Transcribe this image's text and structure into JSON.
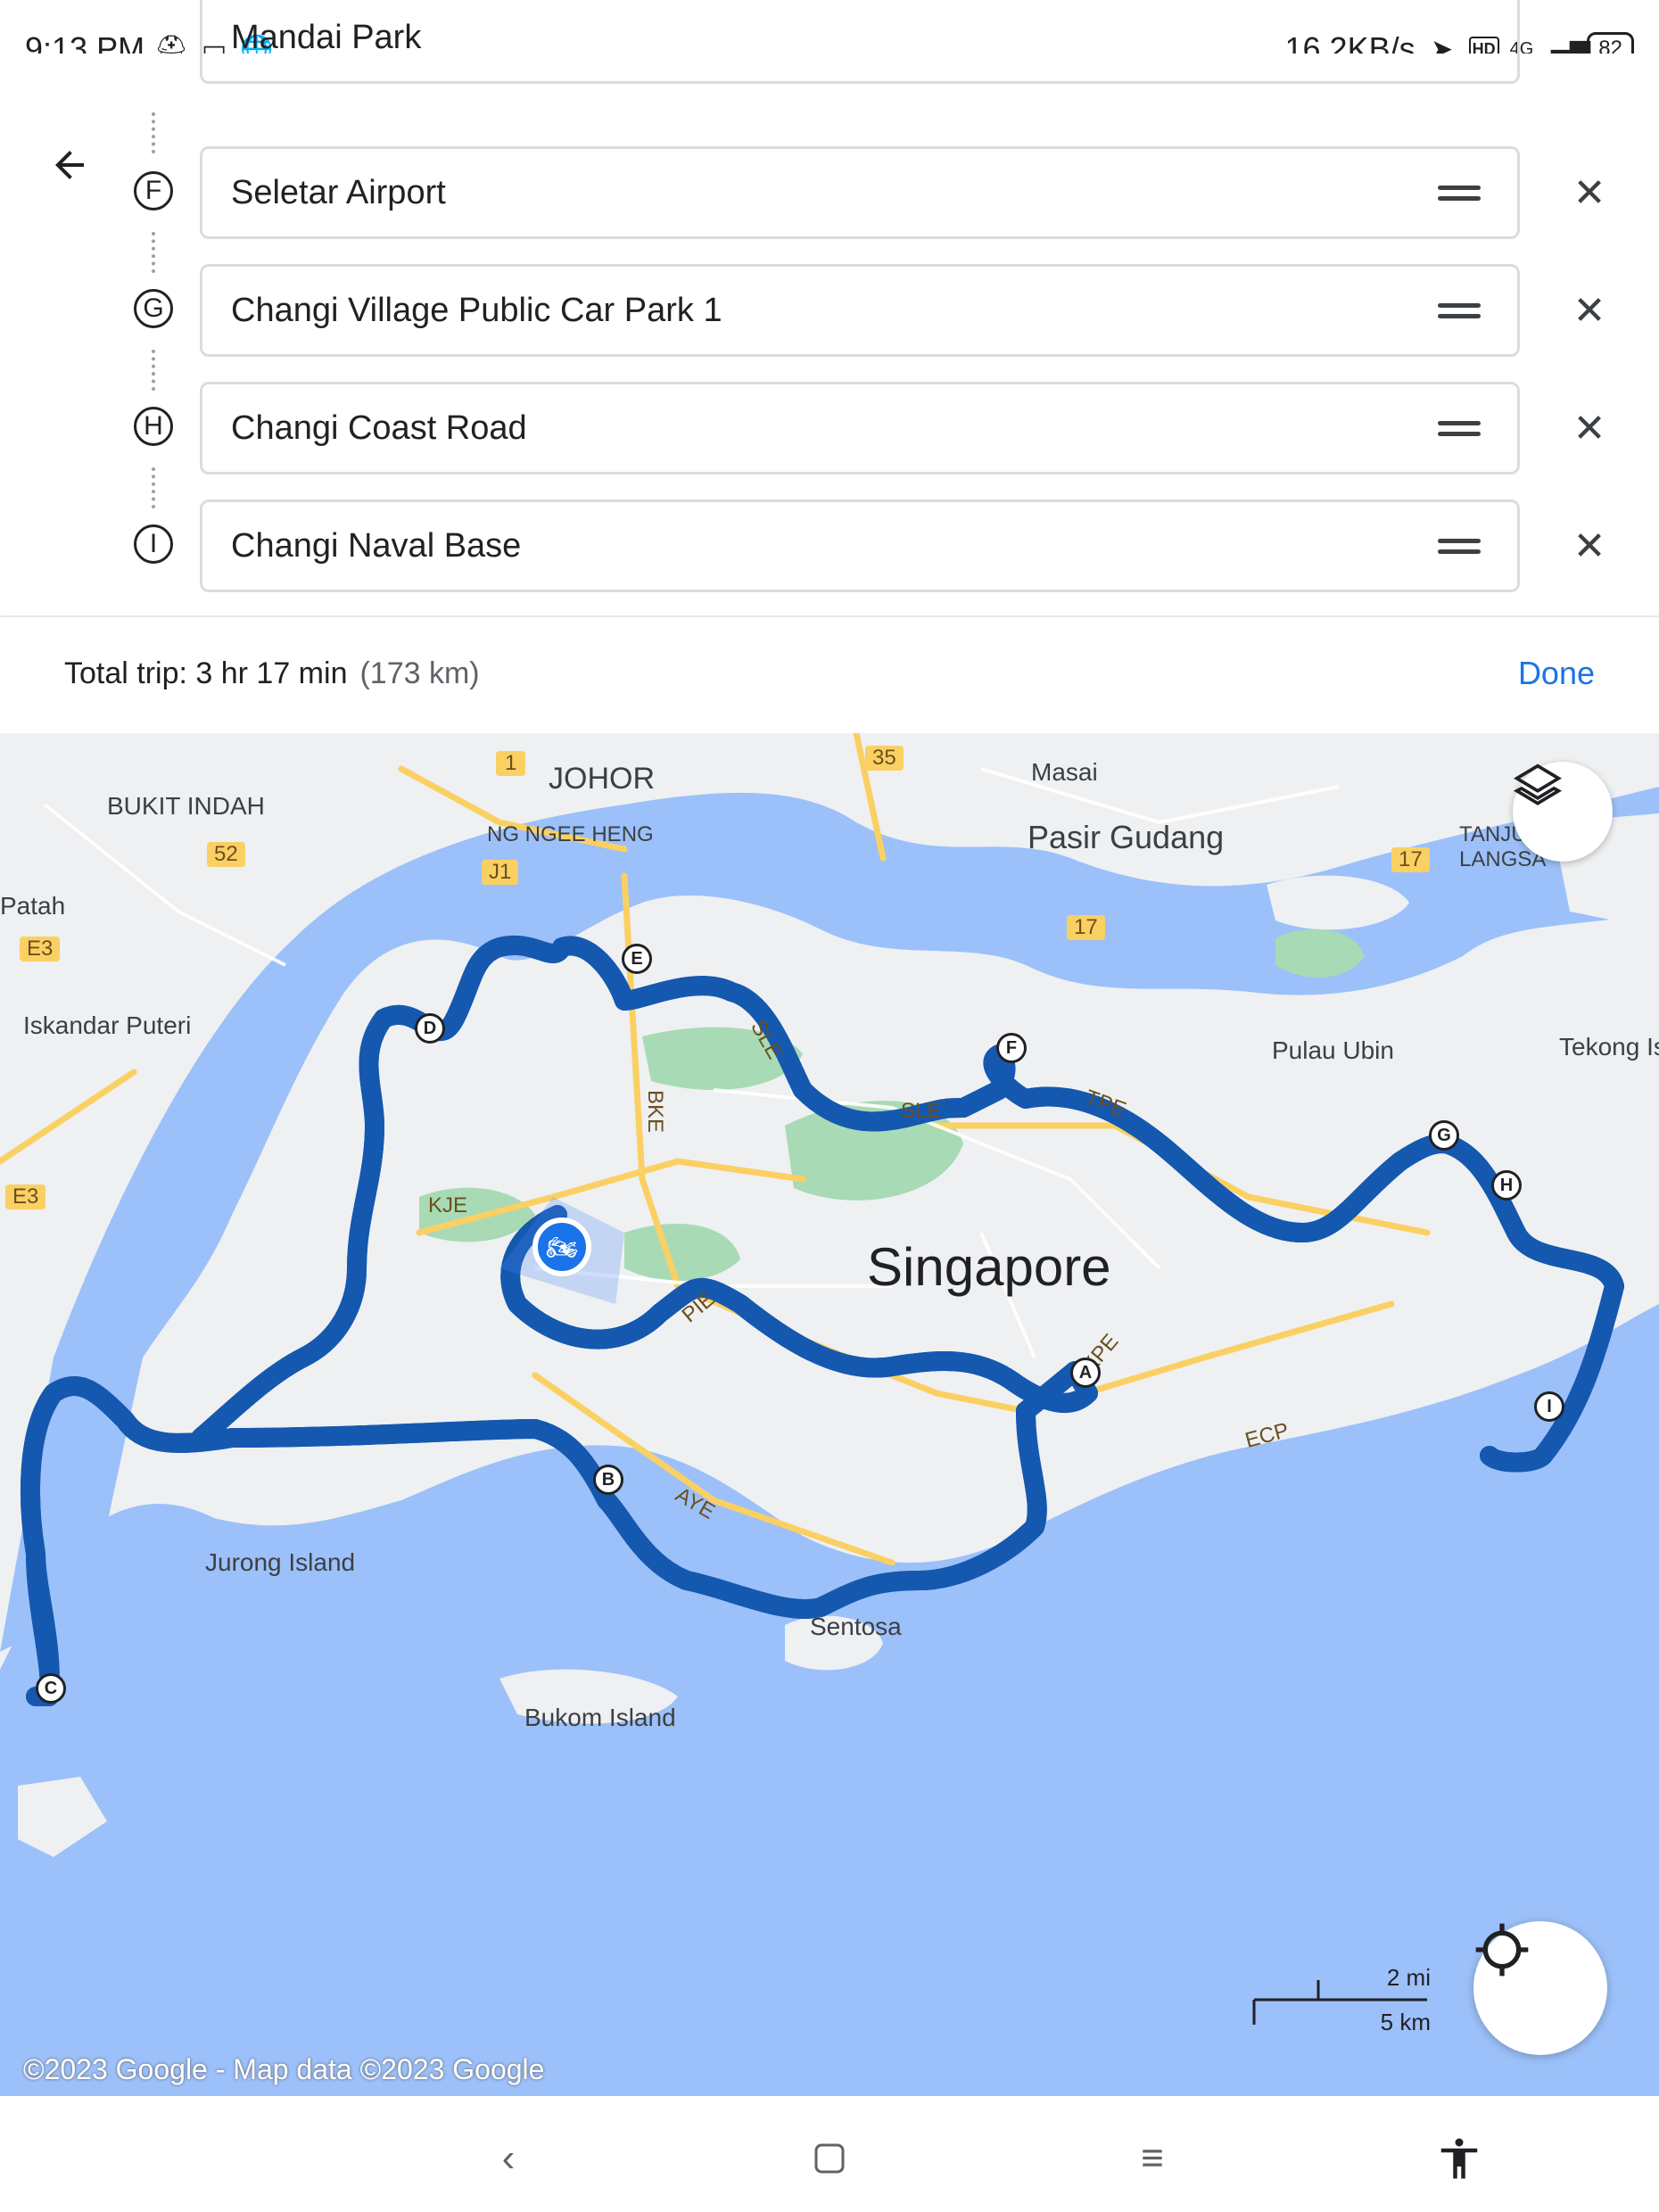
{
  "status_bar": {
    "time": "9:13 PM",
    "speed": "16.2KB/s",
    "network": "4G",
    "battery": "82"
  },
  "stops": [
    {
      "letter": "F",
      "name": "Seletar Airport"
    },
    {
      "letter": "G",
      "name": "Changi Village Public Car Park 1"
    },
    {
      "letter": "H",
      "name": "Changi Coast Road"
    },
    {
      "letter": "I",
      "name": "Changi Naval Base"
    }
  ],
  "partial_stop": "Mandai Park",
  "trip": {
    "label": "Total trip: 3 hr 17 min",
    "distance": "(173 km)",
    "done_label": "Done"
  },
  "map": {
    "labels": {
      "johor": "JOHOR",
      "bukit_indah": "BUKIT INDAH",
      "ng_ngee_heng": "NG NGEE HENG",
      "masai": "Masai",
      "pasir_gudang": "Pasir Gudang",
      "tanjung": "TANJU LANGSA",
      "patah": "Patah",
      "iskandar": "Iskandar Puteri",
      "pulau_ubin": "Pulau Ubin",
      "tekong": "Tekong Is",
      "singapore": "Singapore",
      "jurong": "Jurong Island",
      "sentosa": "Sentosa",
      "bukom": "Bukom Island",
      "kje": "KJE",
      "bke": "BKE",
      "sle1": "SLE",
      "sle2": "SLE",
      "tpe": "TPE",
      "pie": "PIE",
      "aye": "AYE",
      "ecp": "ECP",
      "kpe": "KPE",
      "r1": "1",
      "r35": "35",
      "r52": "52",
      "r17a": "17",
      "r17b": "17",
      "j1": "J1",
      "e3a": "E3",
      "e3b": "E3"
    },
    "markers": [
      "A",
      "B",
      "C",
      "D",
      "E",
      "F",
      "G",
      "H",
      "I"
    ],
    "scale_mi": "2 mi",
    "scale_km": "5 km",
    "copyright": "©2023 Google - Map data ©2023 Google",
    "colors": {
      "water": "#9cc0f9",
      "land": "#eef0f2",
      "route": "#1a73e8",
      "park": "#a8dab5",
      "road": "#fbd063"
    }
  }
}
